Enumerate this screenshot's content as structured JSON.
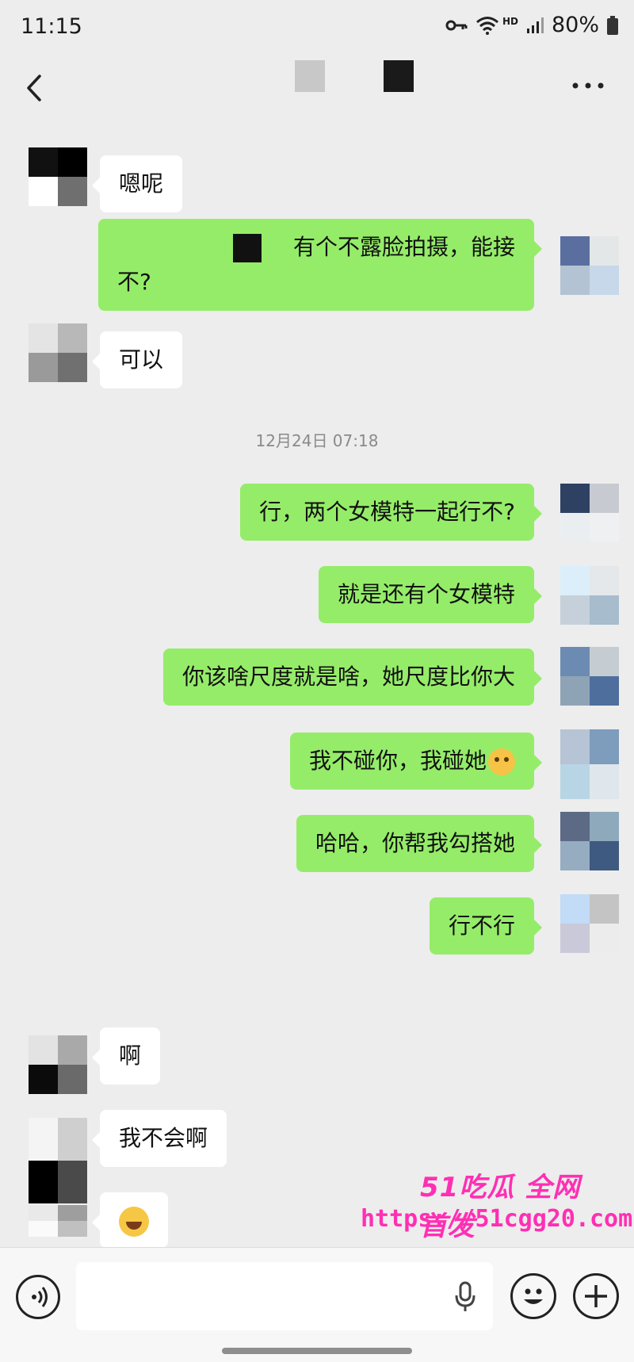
{
  "status_bar": {
    "time": "11:15",
    "hd": "HD",
    "battery": "80%"
  },
  "chat": {
    "timestamp": "12月24日 07:18",
    "messages": [
      {
        "side": "in",
        "text": "嗯呢"
      },
      {
        "side": "out",
        "line1": "有个不露脸拍摄，能接",
        "line2": "不?"
      },
      {
        "side": "in",
        "text": "可以"
      },
      {
        "side": "out",
        "text": "行，两个女模特一起行不?"
      },
      {
        "side": "out",
        "text": "就是还有个女模特"
      },
      {
        "side": "out",
        "text": "你该啥尺度就是啥，她尺度比你大"
      },
      {
        "side": "out",
        "text": "我不碰你，我碰她"
      },
      {
        "side": "out",
        "text": "哈哈，你帮我勾搭她"
      },
      {
        "side": "out",
        "text": "行不行"
      },
      {
        "side": "in",
        "text": "啊"
      },
      {
        "side": "in",
        "text": "我不会啊"
      },
      {
        "side": "in",
        "text": "",
        "emoji": "laughing-tears"
      }
    ]
  },
  "watermark": {
    "line1": "51吃瓜 全网首发",
    "line2": "https://51cgg20.com"
  },
  "icons": {
    "back": "chevron-left-icon",
    "more": "more-dots-icon",
    "voice": "voice-icon",
    "mic": "microphone-icon",
    "emoji": "smiley-icon",
    "add": "plus-icon"
  },
  "colors": {
    "outgoing_bubble": "#95ec69",
    "incoming_bubble": "#ffffff",
    "background": "#ededed",
    "watermark": "#ff2fb3"
  }
}
